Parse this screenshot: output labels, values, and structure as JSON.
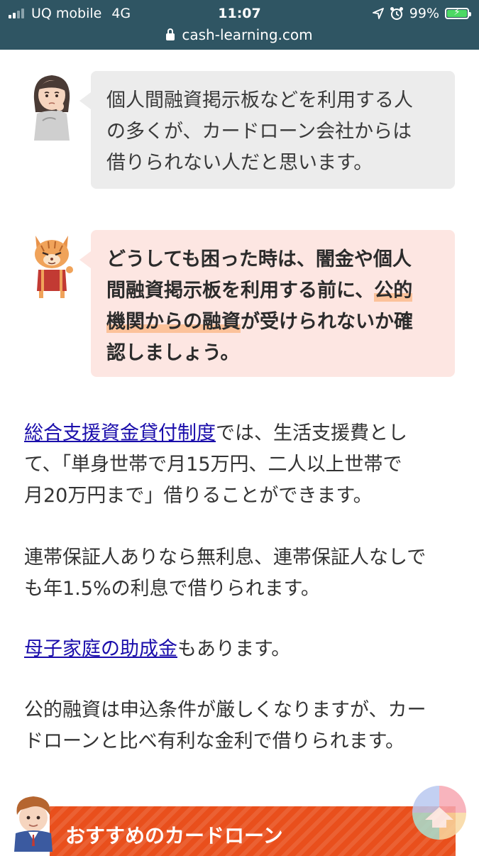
{
  "status_bar": {
    "carrier": "UQ mobile",
    "network": "4G",
    "time": "11:07",
    "battery_percent": "99%",
    "battery_level": 0.99,
    "url": "cash-learning.com"
  },
  "bubbles": [
    {
      "speaker": "woman",
      "lines": [
        "個人間融資掲示板などを利用する人",
        "の多くが、カードローン会社からは",
        "借りられない人だと思います。"
      ]
    },
    {
      "speaker": "cat",
      "line1": "どうしても困った時は、闇金や個人",
      "line2_plain": "間融資掲示板を利用する前に、",
      "line2_marked": "公的",
      "line3_marked": "機関からの融資",
      "line3_plain": "が受けられないか確",
      "line4": "認しましょう。"
    }
  ],
  "paragraphs": {
    "p1": {
      "link": "総合支援資金貸付制度",
      "line1_rest": "では、生活支援費とし",
      "line2": "て、「単身世帯で月15万円、二人以上世帯で",
      "line3": "月20万円まで」借りることができます。"
    },
    "p2": {
      "line1": "連帯保証人ありなら無利息、連帯保証人なしで",
      "line2": "も年1.5%の利息で借りられます。"
    },
    "p3": {
      "link": "母子家庭の助成金",
      "rest": "もあります。"
    },
    "p4": {
      "line1": "公的融資は申込条件が厳しくなりますが、カー",
      "line2": "ドローンと比べ有利な金利で借りられます。"
    }
  },
  "banner": {
    "title": "おすすめのカードローン"
  },
  "colors": {
    "status_bar": "#2f5563",
    "bubble_gray": "#ececec",
    "bubble_pink": "#fde6e2",
    "marker": "#fcc29a",
    "link": "#1a0dab",
    "banner": "#e94f1c"
  },
  "icons": [
    "signal-icon",
    "location-arrow-icon",
    "alarm-clock-icon",
    "battery-icon",
    "lock-icon",
    "scroll-to-top-icon"
  ]
}
